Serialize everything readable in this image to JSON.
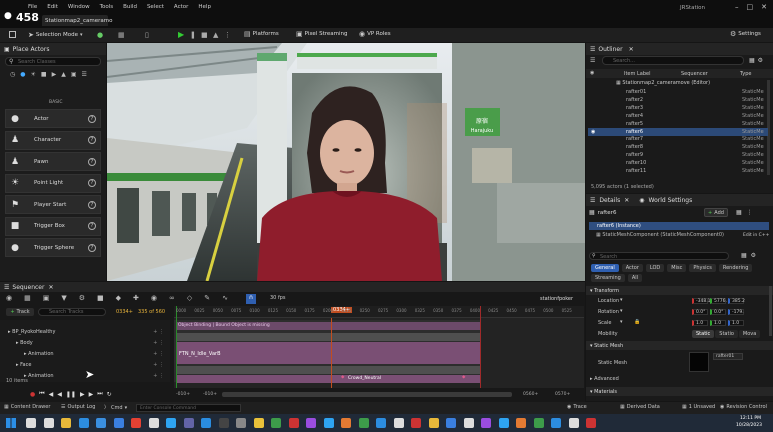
{
  "title_bar": {
    "user_count": "458",
    "project_tab": "Stationmap2_cameramo",
    "menus": [
      "File",
      "Edit",
      "Window",
      "Tools",
      "Build",
      "Select",
      "Actor",
      "Help"
    ],
    "window_name": "JRStation"
  },
  "main_toolbar": {
    "mode": "Selection Mode",
    "platforms": "Platforms",
    "pixel_streaming": "Pixel Streaming",
    "vp_roles": "VP Roles",
    "settings": "Settings"
  },
  "place_actors": {
    "title": "Place Actors",
    "search_placeholder": "Search Classes",
    "section": "BASIC",
    "items": [
      {
        "label": "Actor",
        "icon": "actor-icon"
      },
      {
        "label": "Character",
        "icon": "character-icon"
      },
      {
        "label": "Pawn",
        "icon": "pawn-icon"
      },
      {
        "label": "Point Light",
        "icon": "point-light-icon"
      },
      {
        "label": "Player Start",
        "icon": "player-start-icon"
      },
      {
        "label": "Trigger Box",
        "icon": "trigger-box-icon"
      },
      {
        "label": "Trigger Sphere",
        "icon": "trigger-sphere-icon"
      }
    ]
  },
  "viewport": {
    "sign_text": "Harajuku",
    "sign_jp": "原宿"
  },
  "outliner": {
    "title": "Outliner",
    "search_placeholder": "Search...",
    "col_label": "Item Label",
    "col_seq": "Sequencer",
    "col_type": "Type",
    "root": "Stationmap2_cameramove (Editor)",
    "rows": [
      {
        "name": "rafter01",
        "type": "StaticMe"
      },
      {
        "name": "rafter2",
        "type": "StaticMe"
      },
      {
        "name": "rafter3",
        "type": "StaticMe"
      },
      {
        "name": "rafter4",
        "type": "StaticMe"
      },
      {
        "name": "rafter5",
        "type": "StaticMe"
      },
      {
        "name": "rafter6",
        "type": "StaticMe"
      },
      {
        "name": "rafter7",
        "type": "StaticMe"
      },
      {
        "name": "rafter8",
        "type": "StaticMe"
      },
      {
        "name": "rafter9",
        "type": "StaticMe"
      },
      {
        "name": "rafter10",
        "type": "StaticMe"
      },
      {
        "name": "rafter11",
        "type": "StaticMe"
      }
    ],
    "count": "5,095 actors (1 selected)"
  },
  "details": {
    "title": "Details",
    "world_settings": "World Settings",
    "object_name": "rafter6",
    "add_label": "Add",
    "instance": "rafter6 (Instance)",
    "component": "StaticMeshComponent (StaticMeshComponent0)",
    "edit_cpp": "Edit in C++",
    "search_placeholder": "Search",
    "tabs": [
      "General",
      "Actor",
      "LOD",
      "Misc",
      "Physics",
      "Rendering",
      "Streaming",
      "All"
    ],
    "transform_section": "Transform",
    "location_label": "Location",
    "location_vals": [
      "-348.1",
      "5776.",
      "385.2"
    ],
    "rotation_label": "Rotation",
    "rotation_vals": [
      "0.0°",
      "0.0°",
      "-179."
    ],
    "scale_label": "Scale",
    "scale_vals": [
      "1.0",
      "1.0",
      "1.0"
    ],
    "mobility_label": "Mobility",
    "mobility_opts": [
      "Static",
      "Statio",
      "Mova"
    ],
    "static_mesh_section": "Static Mesh",
    "static_mesh_label": "Static Mesh",
    "mesh_name": "rafter01",
    "advanced": "Advanced",
    "materials": "Materials"
  },
  "sequencer": {
    "tab": "Sequencer",
    "fps": "30 fps",
    "frame_marker": "0334+",
    "sequence_name": "stationfpoker",
    "track_label": "Track",
    "search_placeholder": "Search Tracks",
    "frame_current": "0334+",
    "frame_total": "335 of 560",
    "tracks": [
      {
        "label": "BP_RyokoHealthy",
        "indent": 0
      },
      {
        "label": "Body",
        "indent": 1
      },
      {
        "label": "Animation",
        "indent": 2
      },
      {
        "label": "Face",
        "indent": 1
      },
      {
        "label": "Animation",
        "indent": 2
      }
    ],
    "add_track": "+ Track",
    "items_count": "10 items",
    "clip_top": "Object Binding | Bound Object is missing",
    "clip_anim": "FTN_N_Idle_VarB",
    "clip_face": "Crowd_Neutral",
    "ticks": [
      "0000",
      "0025",
      "0050",
      "0075",
      "0100",
      "0125",
      "0150",
      "0175",
      "0200",
      "0225",
      "0250",
      "0275",
      "0300",
      "0325",
      "0350",
      "0375",
      "0400",
      "0425",
      "0450",
      "0475",
      "0500",
      "0525"
    ],
    "range_start": "-010+",
    "range_start2": "-010+",
    "range_end": "0560+",
    "range_end2": "0570+"
  },
  "bottom_bar": {
    "content_drawer": "Content Drawer",
    "output_log": "Output Log",
    "cmd": "Cmd",
    "console_placeholder": "Enter Console Command",
    "trace": "Trace",
    "derived_data": "Derived Data",
    "unsaved": "1 Unsaved",
    "revision": "Revision Control"
  },
  "taskbar": {
    "time": "12:11 PM",
    "date": "10/28/2023"
  }
}
